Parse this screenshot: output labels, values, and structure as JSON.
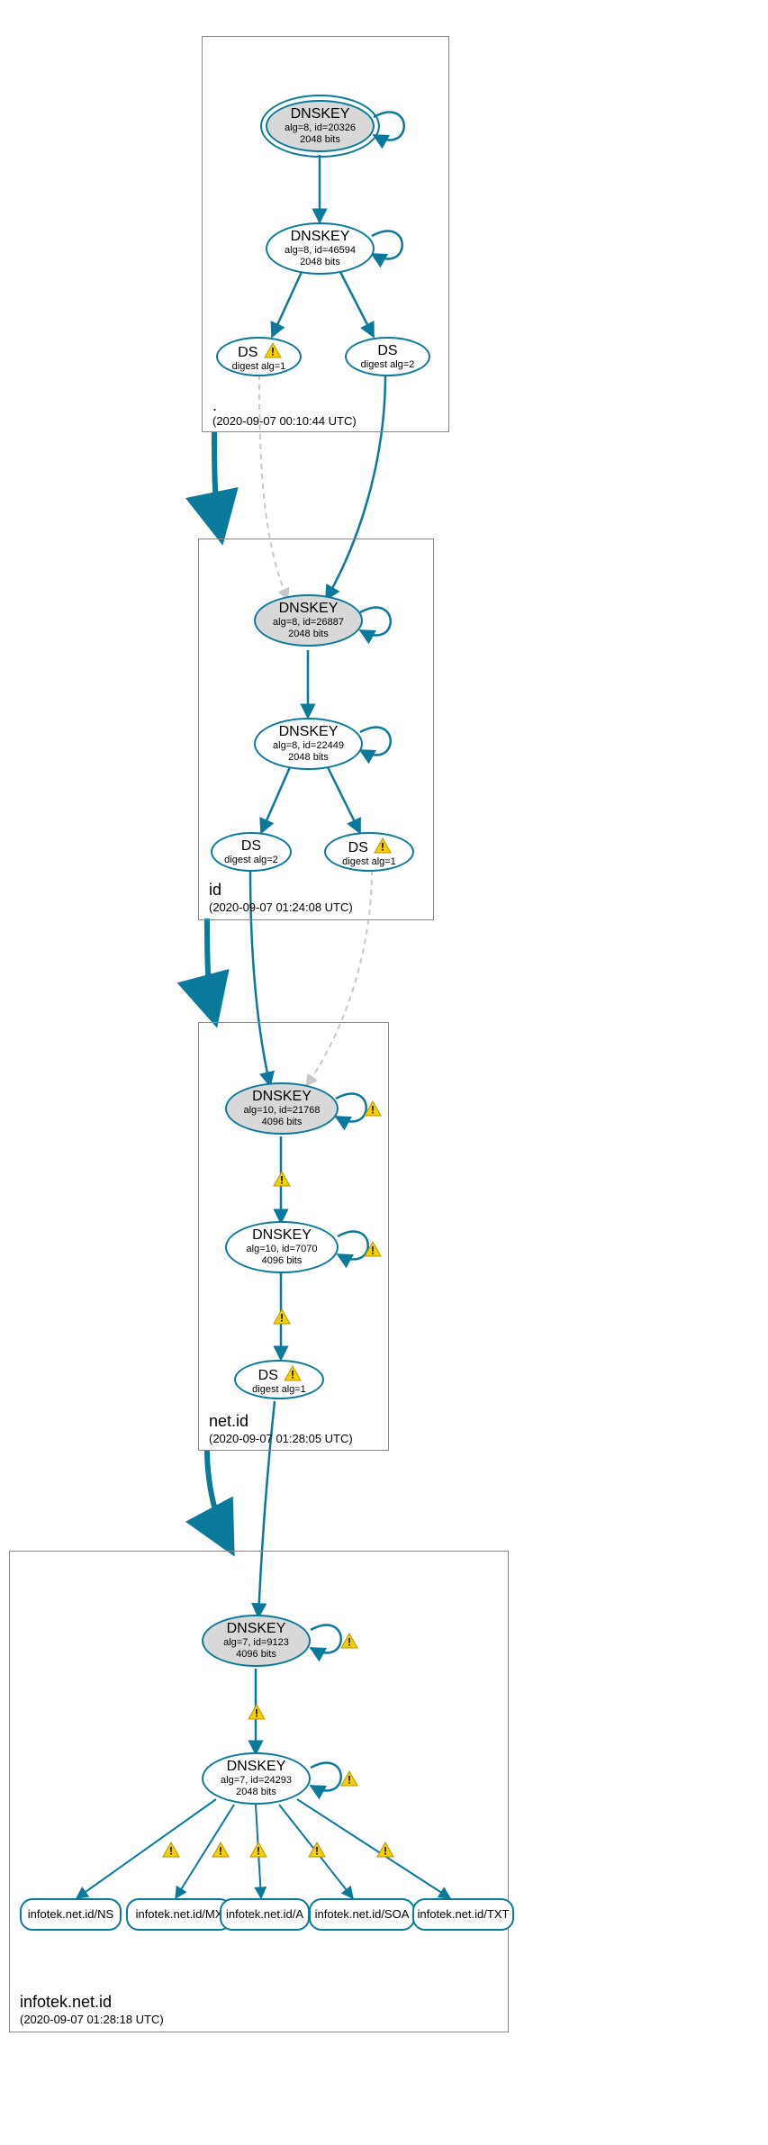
{
  "zones": {
    "root": {
      "name": ".",
      "timestamp": "(2020-09-07 00:10:44 UTC)"
    },
    "id": {
      "name": "id",
      "timestamp": "(2020-09-07 01:24:08 UTC)"
    },
    "netid": {
      "name": "net.id",
      "timestamp": "(2020-09-07 01:28:05 UTC)"
    },
    "infotek": {
      "name": "infotek.net.id",
      "timestamp": "(2020-09-07 01:28:18 UTC)"
    }
  },
  "nodes": {
    "root_ksk": {
      "title": "DNSKEY",
      "line2": "alg=8, id=20326",
      "line3": "2048 bits"
    },
    "root_zsk": {
      "title": "DNSKEY",
      "line2": "alg=8, id=46594",
      "line3": "2048 bits"
    },
    "root_ds1": {
      "title": "DS",
      "line2": "digest alg=1"
    },
    "root_ds2": {
      "title": "DS",
      "line2": "digest alg=2"
    },
    "id_ksk": {
      "title": "DNSKEY",
      "line2": "alg=8, id=26887",
      "line3": "2048 bits"
    },
    "id_zsk": {
      "title": "DNSKEY",
      "line2": "alg=8, id=22449",
      "line3": "2048 bits"
    },
    "id_ds2": {
      "title": "DS",
      "line2": "digest alg=2"
    },
    "id_ds1": {
      "title": "DS",
      "line2": "digest alg=1"
    },
    "netid_ksk": {
      "title": "DNSKEY",
      "line2": "alg=10, id=21768",
      "line3": "4096 bits"
    },
    "netid_zsk": {
      "title": "DNSKEY",
      "line2": "alg=10, id=7070",
      "line3": "4096 bits"
    },
    "netid_ds": {
      "title": "DS",
      "line2": "digest alg=1"
    },
    "info_ksk": {
      "title": "DNSKEY",
      "line2": "alg=7, id=9123",
      "line3": "4096 bits"
    },
    "info_zsk": {
      "title": "DNSKEY",
      "line2": "alg=7, id=24293",
      "line3": "2048 bits"
    },
    "rr_ns": {
      "title": "infotek.net.id/NS"
    },
    "rr_mx": {
      "title": "infotek.net.id/MX"
    },
    "rr_a": {
      "title": "infotek.net.id/A"
    },
    "rr_soa": {
      "title": "infotek.net.id/SOA"
    },
    "rr_txt": {
      "title": "infotek.net.id/TXT"
    }
  },
  "labels": {
    "warn": "!"
  }
}
